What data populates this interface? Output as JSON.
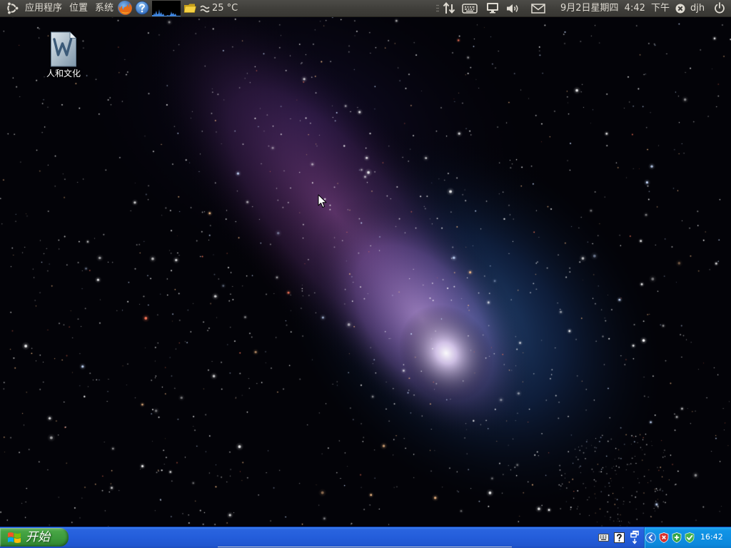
{
  "top_panel": {
    "logo_icon": "ubuntu-logo-icon",
    "menus": [
      {
        "label": "应用程序"
      },
      {
        "label": "位置"
      },
      {
        "label": "系统"
      }
    ],
    "launchers": [
      {
        "icon": "firefox-icon"
      },
      {
        "icon": "help-icon"
      },
      {
        "icon": "system-monitor-icon"
      },
      {
        "icon": "folder-icon"
      }
    ],
    "weather": {
      "icon": "fog-icon",
      "temperature": "25 °C"
    },
    "indicators": [
      {
        "icon": "network-icon"
      },
      {
        "icon": "keyboard-icon"
      },
      {
        "icon": "display-icon"
      },
      {
        "icon": "volume-icon"
      },
      {
        "icon": "mail-icon"
      }
    ],
    "clock": "9月2日星期四 4:42 下午",
    "user": {
      "icon": "user-status-icon",
      "name": "djh"
    },
    "session_icon": "power-icon",
    "colors": {
      "background": "#3c3b37",
      "text": "#dfdbd2"
    }
  },
  "desktop": {
    "icons": [
      {
        "icon": "word-document-icon",
        "label": "人和文化"
      }
    ]
  },
  "taskbar": {
    "start": {
      "icon": "windows-flag-icon",
      "label": "开始"
    },
    "quick_icons": [
      {
        "icon": "keyboard-icon"
      },
      {
        "icon": "help-icon"
      },
      {
        "icon": "restore-windows-icon"
      }
    ],
    "tray_icons": [
      {
        "icon": "back-arrow-icon"
      },
      {
        "icon": "red-shield-icon"
      },
      {
        "icon": "green-shield-plus-icon"
      },
      {
        "icon": "green-shield-check-icon"
      }
    ],
    "clock": "16:42",
    "colors": {
      "bar": "#245edb",
      "start_button": "#3c9a3c",
      "tray": "#0f8fe4"
    }
  }
}
